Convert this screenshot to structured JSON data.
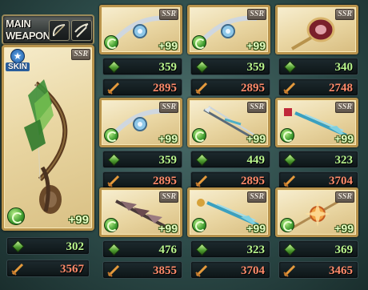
{
  "main_weapon": {
    "header_line1": "MAIN",
    "header_line2": "WEAPON",
    "type_icons": [
      "bow-icon",
      "crossbow-icon"
    ],
    "skin_label": "SKIN",
    "rarity": "SSR",
    "plus": "+99",
    "element": "wind",
    "hp": "302",
    "atk": "3567"
  },
  "weapons": [
    {
      "name": "blue-jeweled-blade",
      "rarity": "SSR",
      "plus": "+99",
      "element": "wind",
      "hp": "359",
      "atk": "2895"
    },
    {
      "name": "blue-jeweled-blade",
      "rarity": "SSR",
      "plus": "+99",
      "element": "wind",
      "hp": "359",
      "atk": "2895"
    },
    {
      "name": "crimson-orb-staff",
      "rarity": "SSR",
      "plus": "",
      "element": "",
      "hp": "340",
      "atk": "2748"
    },
    {
      "name": "blue-jeweled-blade",
      "rarity": "SSR",
      "plus": "+99",
      "element": "wind",
      "hp": "359",
      "atk": "2895"
    },
    {
      "name": "twin-prong-spear",
      "rarity": "SSR",
      "plus": "+99",
      "element": "wind",
      "hp": "449",
      "atk": "2895"
    },
    {
      "name": "feathered-bow",
      "rarity": "SSR",
      "plus": "+99",
      "element": "wind",
      "hp": "323",
      "atk": "3704"
    },
    {
      "name": "dark-feathered-lance",
      "rarity": "SSR",
      "plus": "+99",
      "element": "wind",
      "hp": "476",
      "atk": "3855"
    },
    {
      "name": "feathered-bow",
      "rarity": "SSR",
      "plus": "+99",
      "element": "wind",
      "hp": "323",
      "atk": "3704"
    },
    {
      "name": "radiant-star-spear",
      "rarity": "SSR",
      "plus": "+99",
      "element": "wind",
      "hp": "369",
      "atk": "3465"
    }
  ],
  "colors": {
    "hp_text": "#b9f58c",
    "atk_text": "#ff8a6a",
    "card_border": "#b8934c",
    "wind_element": "#3d9a2d"
  }
}
